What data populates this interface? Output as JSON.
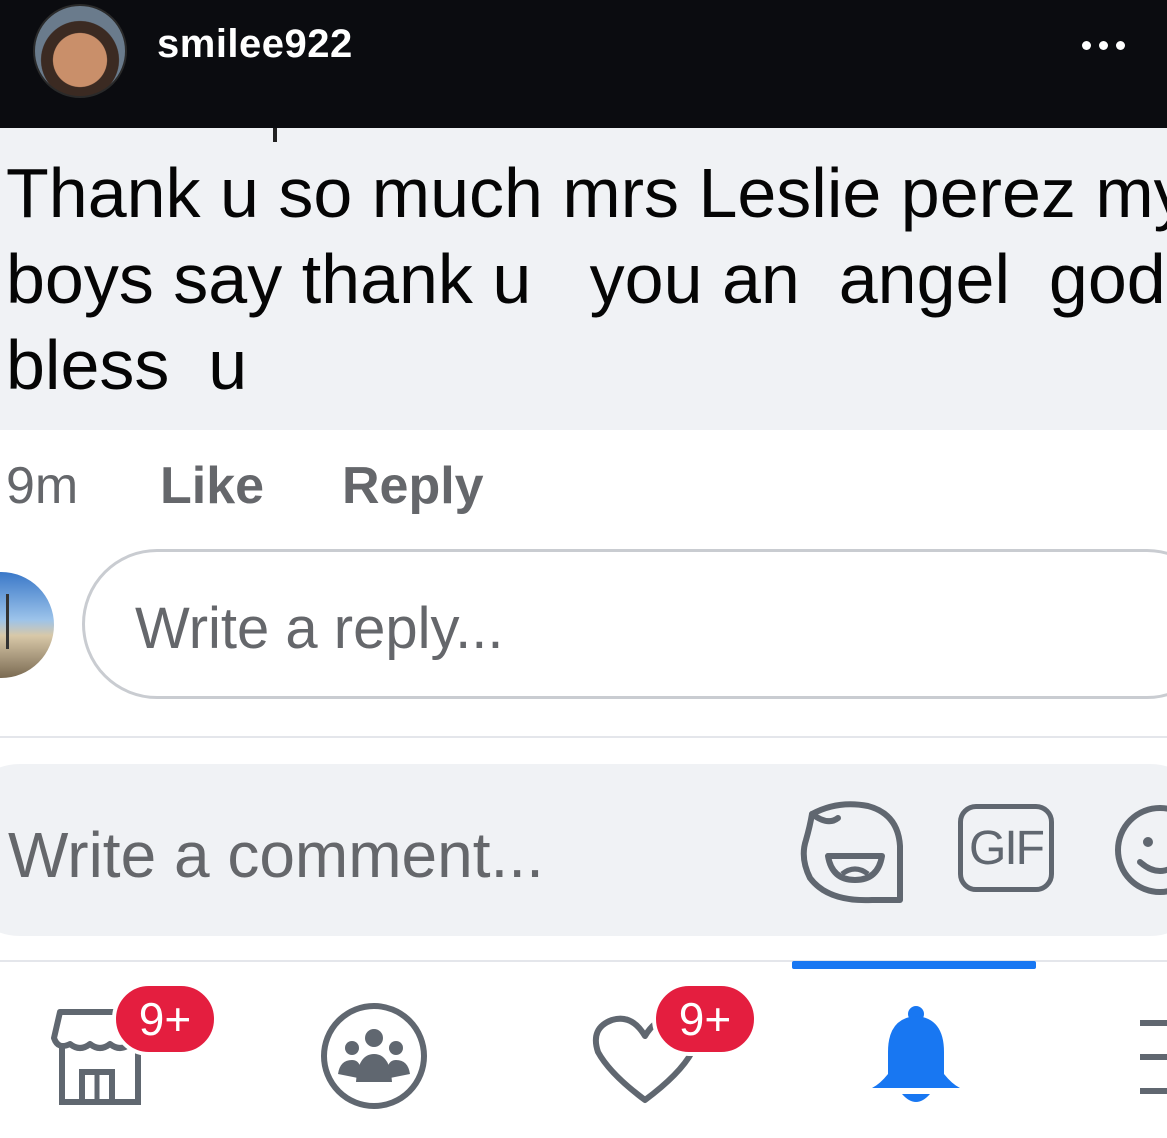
{
  "header": {
    "username": "smilee922"
  },
  "comment": {
    "lines": [
      "Thank u so much mrs Leslie perez my",
      "boys say thank u   you an  angel  god",
      "bless  u"
    ],
    "time": "9m",
    "like_label": "Like",
    "reply_label": "Reply"
  },
  "reply_box": {
    "placeholder": "Write a reply..."
  },
  "comment_bar": {
    "placeholder": "Write a comment...",
    "gif_label": "GIF"
  },
  "bottom_nav": {
    "items": [
      {
        "icon": "marketplace-icon",
        "badge": "9+"
      },
      {
        "icon": "groups-icon"
      },
      {
        "icon": "dating-icon",
        "badge": "9+"
      },
      {
        "icon": "notifications-bell-icon",
        "active": true
      },
      {
        "icon": "menu-icon"
      }
    ]
  },
  "colors": {
    "accent": "#1877f2",
    "badge": "#e41e3f",
    "top_bar": "#0b0c10",
    "bubble": "#f0f2f5"
  }
}
